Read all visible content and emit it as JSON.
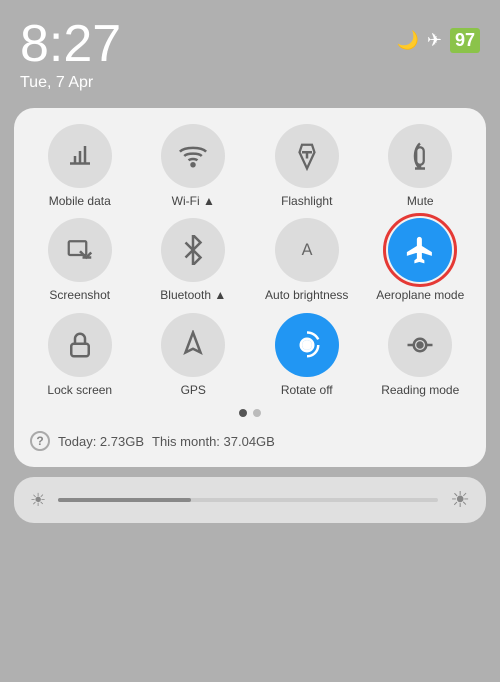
{
  "statusBar": {
    "time": "8:27",
    "date": "Tue, 7 Apr",
    "battery": "97"
  },
  "tiles": [
    {
      "id": "mobile-data",
      "label": "Mobile data",
      "icon": "mobile",
      "active": false,
      "highlighted": false
    },
    {
      "id": "wifi",
      "label": "Wi-Fi",
      "icon": "wifi",
      "active": false,
      "highlighted": false
    },
    {
      "id": "flashlight",
      "label": "Flashlight",
      "icon": "flashlight",
      "active": false,
      "highlighted": false
    },
    {
      "id": "mute",
      "label": "Mute",
      "icon": "mute",
      "active": false,
      "highlighted": false
    },
    {
      "id": "screenshot",
      "label": "Screenshot",
      "icon": "screenshot",
      "active": false,
      "highlighted": false
    },
    {
      "id": "bluetooth",
      "label": "Bluetooth",
      "icon": "bluetooth",
      "active": false,
      "highlighted": false
    },
    {
      "id": "auto-brightness",
      "label": "Auto brightness",
      "icon": "auto-brightness",
      "active": false,
      "highlighted": false
    },
    {
      "id": "aeroplane-mode",
      "label": "Aeroplane mode",
      "icon": "aeroplane",
      "active": true,
      "highlighted": true
    },
    {
      "id": "lock-screen",
      "label": "Lock screen",
      "icon": "lock",
      "active": false,
      "highlighted": false
    },
    {
      "id": "gps",
      "label": "GPS",
      "icon": "gps",
      "active": false,
      "highlighted": false
    },
    {
      "id": "rotate-off",
      "label": "Rotate off",
      "icon": "rotate",
      "active": true,
      "highlighted": false
    },
    {
      "id": "reading-mode",
      "label": "Reading mode",
      "icon": "reading",
      "active": false,
      "highlighted": false
    }
  ],
  "dots": [
    true,
    false
  ],
  "dataRow": {
    "icon": "?",
    "today": "Today: 2.73GB",
    "thisMonth": "This month: 37.04GB"
  },
  "brightness": {
    "fillPercent": 35
  }
}
